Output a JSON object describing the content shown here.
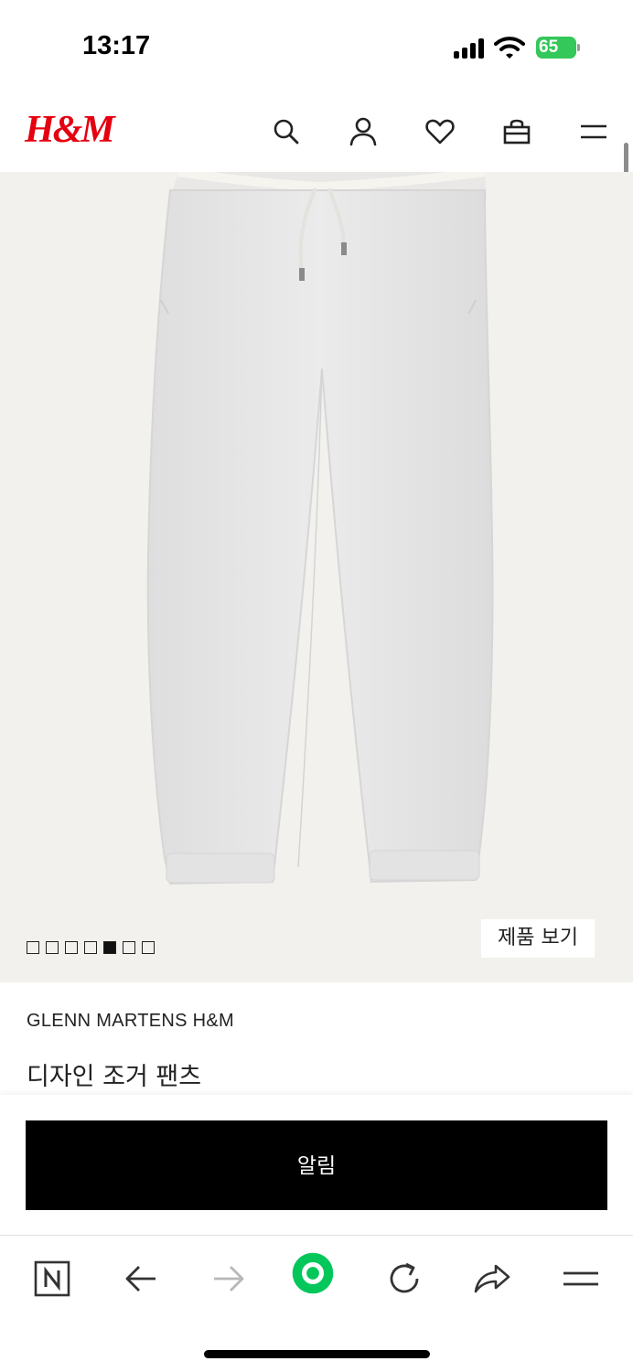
{
  "status_bar": {
    "time": "13:17",
    "battery_percent": "65",
    "icons": [
      "cellular-signal-icon",
      "wifi-icon",
      "battery-charging-icon"
    ]
  },
  "header": {
    "logo": "H&M",
    "icons": [
      "search-icon",
      "account-icon",
      "heart-icon",
      "shopping-bag-icon",
      "menu-icon"
    ]
  },
  "gallery": {
    "image_subject": "grey-jogger-pants",
    "total_images": 7,
    "active_index": 4,
    "view_button_label": "제품 보기"
  },
  "product": {
    "brand": "GLENN MARTENS H&M",
    "name": "디자인 조거 팬츠"
  },
  "cta": {
    "notify_label": "알림"
  },
  "browser_toolbar": {
    "icons": [
      "naver-n-icon",
      "back-arrow-icon",
      "forward-arrow-icon",
      "green-dot-icon",
      "reload-icon",
      "share-icon",
      "menu-icon"
    ]
  },
  "colors": {
    "brand_red": "#e50010",
    "gallery_bg": "#f2f1ee",
    "cta_bg": "#000000",
    "naver_green": "#03c75a"
  }
}
